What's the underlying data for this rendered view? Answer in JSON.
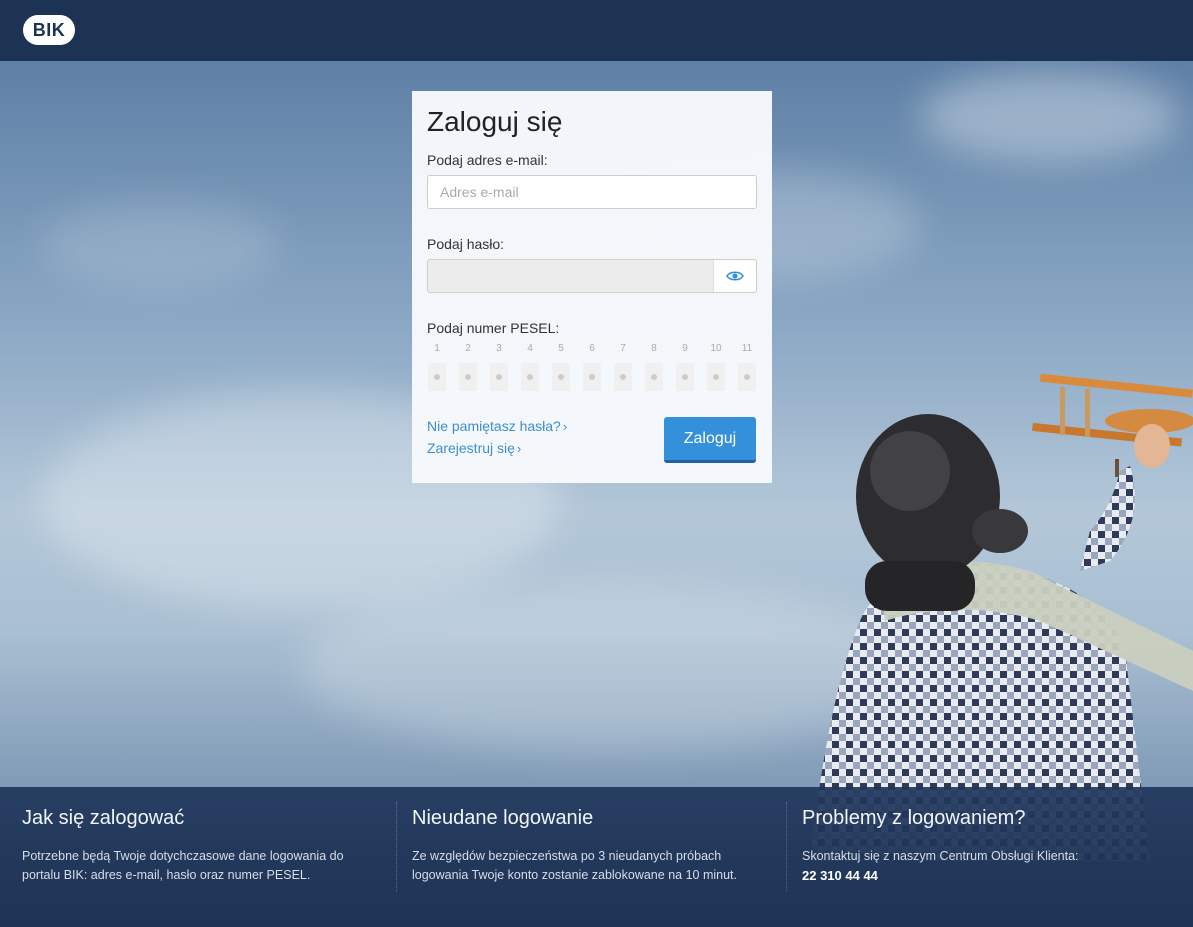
{
  "header": {
    "logo_text": "BIK"
  },
  "login": {
    "title": "Zaloguj się",
    "email_label": "Podaj adres e-mail:",
    "email_placeholder": "Adres e-mail",
    "email_value": "",
    "password_label": "Podaj hasło:",
    "password_value": "",
    "pesel_label": "Podaj numer PESEL:",
    "pesel_digits": [
      "1",
      "2",
      "3",
      "4",
      "5",
      "6",
      "7",
      "8",
      "9",
      "10",
      "11"
    ],
    "forgot_link": "Nie pamiętasz hasła?",
    "register_link": "Zarejestruj się",
    "submit_label": "Zaloguj"
  },
  "info": [
    {
      "title": "Jak się zalogować",
      "text": "Potrzebne będą Twoje dotychczasowe dane logowania do portalu BIK: adres e-mail, hasło oraz numer PESEL."
    },
    {
      "title": "Nieudane logowanie",
      "text": "Ze względów bezpieczeństwa po 3 nieudanych próbach logowania Twoje konto zostanie zablokowane na 10 minut."
    },
    {
      "title": "Problemy z logowaniem?",
      "text": "Skontaktuj się z naszym Centrum Obsługi Klienta:",
      "phone": "22 310 44 44"
    }
  ],
  "colors": {
    "header": "#1c3354",
    "accent": "#3590db",
    "link": "#3b8fd1"
  },
  "icons": {
    "eye": "eye-icon",
    "chevron": "chevron-right-icon"
  }
}
